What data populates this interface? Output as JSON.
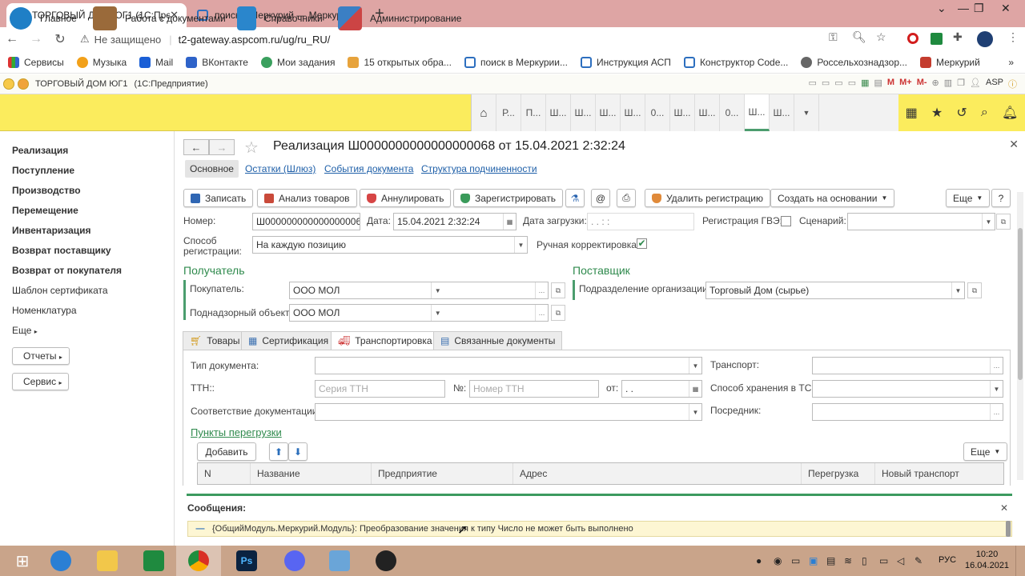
{
  "browser": {
    "tabs": [
      {
        "title": "ТОРГОВЫЙ ДОМ ЮГ1 (1С:Пред",
        "active": true
      },
      {
        "title": "поиск в Меркурий — Меркури",
        "active": false
      }
    ],
    "security_label": "Не защищено",
    "url": "t2-gateway.aspcom.ru/ug/ru_RU/",
    "bookmarks": [
      "Сервисы",
      "Музыка",
      "Mail",
      "ВКонтакте",
      "Мои задания",
      "15 открытых обра...",
      "поиск в Меркурии...",
      "Инструкция АСП",
      "Конструктор Code...",
      "Россельхознадзор...",
      "Меркурий"
    ]
  },
  "app": {
    "title": "ТОРГОВЫЙ ДОМ ЮГ1",
    "subtitle": "(1С:Предприятие)",
    "user": "ASP",
    "sections": [
      {
        "label": "Главное",
        "icon": "home-icon",
        "color": "#1f7fc6"
      },
      {
        "label": "Работа с документами",
        "icon": "briefcase-icon",
        "color": "#9a6a3a"
      },
      {
        "label": "Справочники",
        "icon": "book-icon",
        "color": "#2a86cc"
      },
      {
        "label": "Администрирование",
        "icon": "tools-icon",
        "color": "#3b7fc4"
      }
    ],
    "open_windows": [
      "Р...",
      "П...",
      "Ш...",
      "Ш...",
      "Ш...",
      "Ш...",
      "0...",
      "Ш...",
      "Ш...",
      "0...",
      "Ш...",
      "Ш..."
    ]
  },
  "sidebar": {
    "items": [
      "Реализация",
      "Поступление",
      "Производство",
      "Перемещение",
      "Инвентаризация",
      "Возврат поставщику",
      "Возврат от покупателя"
    ],
    "plain_items": [
      "Шаблон сертификата",
      "Номенклатура",
      "Еще"
    ],
    "buttons": [
      "Отчеты",
      "Сервис"
    ]
  },
  "document": {
    "title": "Реализация Ш0000000000000000068 от 15.04.2021 2:32:24",
    "subtabs": [
      "Основное",
      "Остатки (Шлюз)",
      "События документа",
      "Структура подчиненности"
    ],
    "toolbar": {
      "save": "Записать",
      "analyze": "Анализ товаров",
      "cancel": "Аннулировать",
      "register": "Зарегистрировать",
      "delete_reg": "Удалить регистрацию",
      "create_based": "Создать на основании",
      "more": "Еще",
      "help": "?"
    },
    "fields": {
      "number_label": "Номер:",
      "number_value": "Ш0000000000000000068",
      "date_label": "Дата:",
      "date_value": "15.04.2021  2:32:24",
      "load_date_label": "Дата загрузки:",
      "load_date_value": " .  .       :  :",
      "gve_label": "Регистрация ГВЭ:",
      "scenario_label": "Сценарий:",
      "reg_method_label": "Способ регистрации:",
      "reg_method_value": "На каждую позицию",
      "manual_label": "Ручная корректировка:"
    },
    "recipient": {
      "title": "Получатель",
      "buyer_label": "Покупатель:",
      "buyer_value": "ООО  МОЛ",
      "object_label": "Поднадзорный объект:",
      "object_value": "ООО  МОЛ"
    },
    "supplier": {
      "title": "Поставщик",
      "division_label": "Подразделение организации:",
      "division_value": "Торговый Дом (сырье)"
    },
    "inner_tabs": [
      "Товары",
      "Сертификация",
      "Транспортировка",
      "Связанные документы"
    ],
    "transport": {
      "doc_type_label": "Тип документа:",
      "transport_label": "Транспорт:",
      "ttn_label": "ТТН::",
      "ttn_series_placeholder": "Серия ТТН",
      "no_label": "№:",
      "ttn_number_placeholder": "Номер ТТН",
      "from_label": "от:",
      "from_value": " .  .",
      "storage_label": "Способ хранения в ТС:",
      "conformity_label": "Соответствие документации:",
      "intermediary_label": "Посредник:",
      "unload_points": "Пункты перегрузки",
      "add_button": "Добавить",
      "more_button": "Еще",
      "columns": [
        "N",
        "Название",
        "Предприятие",
        "Адрес",
        "Перегрузка",
        "Новый транспорт"
      ]
    }
  },
  "messages": {
    "title": "Сообщения:",
    "text": "{ОбщийМодуль.Меркурий.Модуль}: Преобразование значения к типу Число не может быть выполнено"
  },
  "taskbar": {
    "language": "РУС",
    "time": "10:20",
    "date": "16.04.2021"
  }
}
